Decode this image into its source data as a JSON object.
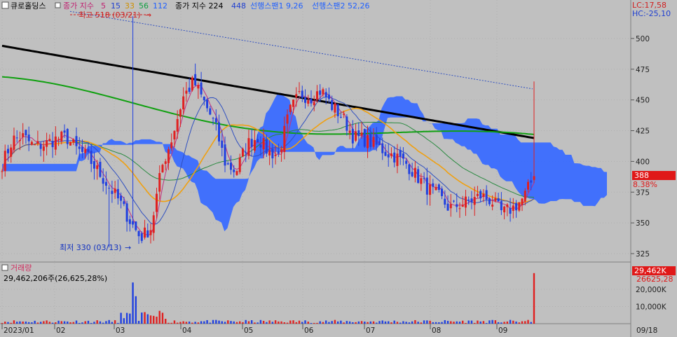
{
  "header": {
    "checkbox_label": "큐로홀딩스",
    "ma_label": "종가 지수",
    "ma_periods": [
      "5",
      "15",
      "33",
      "56",
      "112"
    ],
    "ma_colors": [
      "#e0207a",
      "#2040d0",
      "#e0a000",
      "#10a040",
      "#2060ff"
    ],
    "long_ma_label": "종가 지수 224",
    "long_ma_value": "448",
    "span1_label": "선행스팬1 9,26",
    "span2_label": "선행스팬2 52,26"
  },
  "corner": {
    "lc": "LC:17,58",
    "hc": "HC:-25,10"
  },
  "annotations": {
    "high": "최고 518 (03/21)",
    "low": "최저 330 (03/13)"
  },
  "price_panel": {
    "current_value": "388",
    "current_change": "8.38%"
  },
  "volume_panel": {
    "title": "거래량",
    "value_text": "29,462,206주(26,625,28%)",
    "tag_value": "29,462K",
    "tag_sub": "26625,28"
  },
  "colors": {
    "background": "#c0c0c0",
    "up": "#e02020",
    "down": "#2040e0",
    "cloud": "#3a6cff",
    "ma224": "#000000",
    "ma112": "#10a010",
    "ma56": "#2a8a40",
    "ma33": "#f0a010",
    "ma15": "#3050c0",
    "ma5": "#c03080",
    "trendline": "#3050c0"
  },
  "chart_data": [
    {
      "type": "candlestick",
      "title": "큐로홀딩스",
      "x_ticks": [
        "2023/01",
        "02",
        "03",
        "04",
        "05",
        "06",
        "07",
        "08",
        "09",
        "09/18"
      ],
      "ylim": [
        315,
        525
      ],
      "y_ticks": [
        325,
        350,
        375,
        400,
        425,
        450,
        475,
        500
      ],
      "high": {
        "value": 518,
        "date": "03/21"
      },
      "low": {
        "value": 330,
        "date": "03/13"
      },
      "last_close": 388,
      "change_pct": 8.38,
      "close_series_approx": [
        398,
        418,
        420,
        412,
        414,
        418,
        420,
        410,
        404,
        392,
        380,
        368,
        352,
        338,
        346,
        395,
        420,
        452,
        465,
        448,
        430,
        398,
        392,
        414,
        420,
        408,
        405,
        440,
        455,
        452,
        458,
        445,
        436,
        420,
        418,
        414,
        408,
        404,
        398,
        388,
        378,
        372,
        362,
        365,
        368,
        372,
        368,
        358,
        362,
        370,
        388
      ],
      "series": [
        {
          "name": "ma5",
          "period": 5
        },
        {
          "name": "ma15",
          "period": 15
        },
        {
          "name": "ma33",
          "period": 33
        },
        {
          "name": "ma56",
          "period": 56
        },
        {
          "name": "ma112",
          "period": 112
        },
        {
          "name": "ma224",
          "period": 224,
          "value": 448
        },
        {
          "name": "선행스팬1",
          "params": "9,26"
        },
        {
          "name": "선행스팬2",
          "params": "52,26"
        }
      ]
    },
    {
      "type": "bar",
      "title": "거래량",
      "y_ticks": [
        10000,
        20000
      ],
      "y_tick_labels": [
        "10,000K",
        "20,000K"
      ],
      "last_value": 29462206,
      "spikes": [
        {
          "date": "03/21",
          "value": 24000
        },
        {
          "date": "09/18",
          "value": 29462
        }
      ]
    }
  ]
}
